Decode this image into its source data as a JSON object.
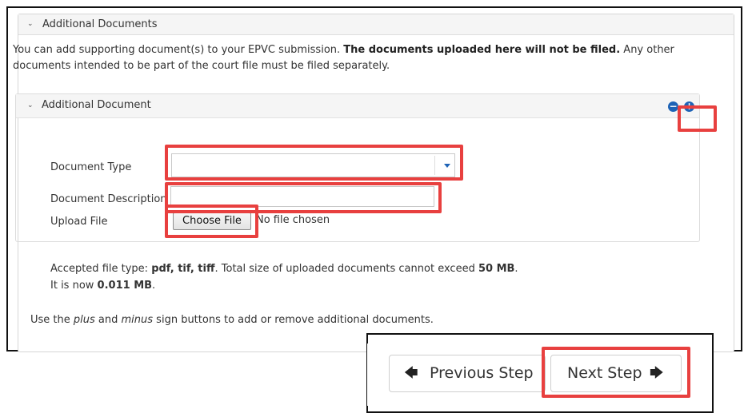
{
  "panel": {
    "title": "Additional Documents",
    "intro_part1": "You can add supporting document(s) to your EPVC submission. ",
    "intro_bold": "The documents uploaded here will not be filed.",
    "intro_part2": " Any other documents intended to be part of the court file must be filed separately."
  },
  "subpanel": {
    "title": "Additional Document",
    "remove_icon": "−",
    "add_icon": "+"
  },
  "form": {
    "document_type_label": "Document Type",
    "document_type_value": "",
    "document_description_label": "Document Description",
    "document_description_value": "",
    "upload_label": "Upload File",
    "choose_file_button": "Choose File",
    "no_file_text": "No file chosen"
  },
  "info": {
    "accepted_prefix": "Accepted file type: ",
    "accepted_types": "pdf, tif, tiff",
    "accepted_mid": ". Total size of uploaded documents cannot exceed ",
    "max_size": "50 MB",
    "accepted_end": ".",
    "now_prefix": "It is now ",
    "current_size": "0.011 MB",
    "now_end": ".",
    "hint_prefix": "Use the ",
    "hint_plus": "plus",
    "hint_and": " and ",
    "hint_minus": "minus",
    "hint_suffix": " sign buttons to add or remove additional documents."
  },
  "nav": {
    "previous_label": "Previous Step",
    "previous_icon": "🡄",
    "next_label": "Next Step",
    "next_icon": "🡆"
  },
  "colors": {
    "highlight": "#e8403f",
    "accent": "#1e63b6"
  }
}
